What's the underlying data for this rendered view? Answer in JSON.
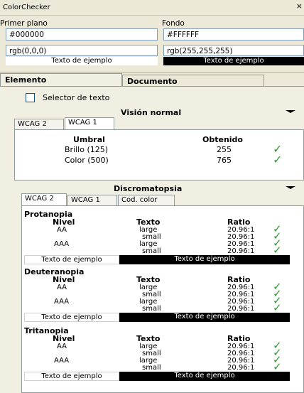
{
  "window": {
    "title": "ColorChecker",
    "close": "×"
  },
  "foreground": {
    "label": "Primer plano",
    "hex": "#000000",
    "rgb": "rgb(0,0,0)",
    "sample": "Texto de ejemplo"
  },
  "background": {
    "label": "Fondo",
    "hex": "#FFFFFF",
    "rgb": "rgb(255,255,255)",
    "sample": "Texto de ejemplo"
  },
  "tabs": {
    "element": "Elemento",
    "document": "Documento"
  },
  "selector": {
    "label": "Selector de texto"
  },
  "normal": {
    "title": "Visión normal",
    "tabs": [
      "WCAG 2",
      "WCAG 1"
    ],
    "headers": [
      "Umbral",
      "Obtenido"
    ],
    "rows": [
      {
        "label": "Brillo (125)",
        "value": "255"
      },
      {
        "label": "Color (500)",
        "value": "765"
      }
    ]
  },
  "dichromacy": {
    "title": "Discromatopsia",
    "tabs": [
      "WCAG 2",
      "WCAG 1",
      "Cod. color"
    ],
    "headers": [
      "Nivel",
      "Texto",
      "Ratio"
    ],
    "groups": [
      {
        "name": "Protanopia",
        "rows": [
          {
            "level": "AA",
            "text": "large",
            "ratio": "20.96:1"
          },
          {
            "level": "",
            "text": "small",
            "ratio": "20.96:1"
          },
          {
            "level": "AAA",
            "text": "large",
            "ratio": "20.96:1"
          },
          {
            "level": "",
            "text": "small",
            "ratio": "20.96:1"
          }
        ],
        "sample_light": "Texto de ejemplo",
        "sample_dark": "Texto de ejemplo"
      },
      {
        "name": "Deuteranopia",
        "rows": [
          {
            "level": "AA",
            "text": "large",
            "ratio": "20.96:1"
          },
          {
            "level": "",
            "text": "small",
            "ratio": "20.96:1"
          },
          {
            "level": "AAA",
            "text": "large",
            "ratio": "20.96:1"
          },
          {
            "level": "",
            "text": "small",
            "ratio": "20.96:1"
          }
        ],
        "sample_light": "Texto de ejemplo",
        "sample_dark": "Texto de ejemplo"
      },
      {
        "name": "Tritanopia",
        "rows": [
          {
            "level": "AA",
            "text": "large",
            "ratio": "20.96:1"
          },
          {
            "level": "",
            "text": "small",
            "ratio": "20.96:1"
          },
          {
            "level": "AAA",
            "text": "large",
            "ratio": "20.96:1"
          },
          {
            "level": "",
            "text": "small",
            "ratio": "20.96:1"
          }
        ],
        "sample_light": "Texto de ejemplo",
        "sample_dark": "Texto de ejemplo"
      }
    ]
  },
  "colors": {
    "pass_check": "#2f9e2f",
    "dark_sample_bg": "#000000",
    "light_sample_bg": "#ffffff"
  }
}
